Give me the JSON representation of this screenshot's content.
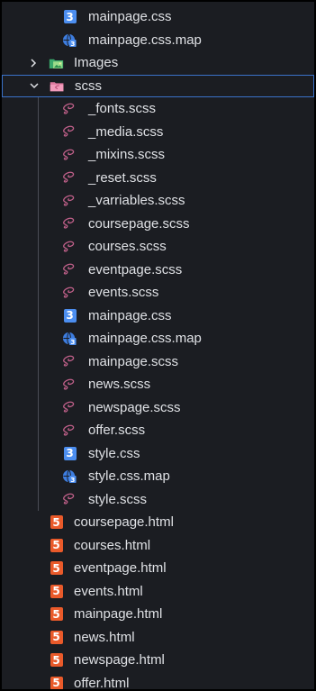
{
  "explorer": {
    "rows": [
      {
        "label": "mainpage.css",
        "icon": "css-file-icon",
        "level": 2
      },
      {
        "label": "mainpage.css.map",
        "icon": "css-map-file-icon",
        "level": 2
      },
      {
        "label": "Images",
        "icon": "images-folder-icon",
        "level": 1,
        "folder": "collapsed"
      },
      {
        "label": "scss",
        "icon": "sass-folder-icon",
        "level": 1,
        "folder": "expanded",
        "selected": true
      },
      {
        "label": "_fonts.scss",
        "icon": "sass-file-icon",
        "level": 2
      },
      {
        "label": "_media.scss",
        "icon": "sass-file-icon",
        "level": 2
      },
      {
        "label": "_mixins.scss",
        "icon": "sass-file-icon",
        "level": 2
      },
      {
        "label": "_reset.scss",
        "icon": "sass-file-icon",
        "level": 2
      },
      {
        "label": "_varriables.scss",
        "icon": "sass-file-icon",
        "level": 2
      },
      {
        "label": "coursepage.scss",
        "icon": "sass-file-icon",
        "level": 2
      },
      {
        "label": "courses.scss",
        "icon": "sass-file-icon",
        "level": 2
      },
      {
        "label": "eventpage.scss",
        "icon": "sass-file-icon",
        "level": 2
      },
      {
        "label": "events.scss",
        "icon": "sass-file-icon",
        "level": 2
      },
      {
        "label": "mainpage.css",
        "icon": "css-file-icon",
        "level": 2
      },
      {
        "label": "mainpage.css.map",
        "icon": "css-map-file-icon",
        "level": 2
      },
      {
        "label": "mainpage.scss",
        "icon": "sass-file-icon",
        "level": 2
      },
      {
        "label": "news.scss",
        "icon": "sass-file-icon",
        "level": 2
      },
      {
        "label": "newspage.scss",
        "icon": "sass-file-icon",
        "level": 2
      },
      {
        "label": "offer.scss",
        "icon": "sass-file-icon",
        "level": 2
      },
      {
        "label": "style.css",
        "icon": "css-file-icon",
        "level": 2
      },
      {
        "label": "style.css.map",
        "icon": "css-map-file-icon",
        "level": 2
      },
      {
        "label": "style.scss",
        "icon": "sass-file-icon",
        "level": 2
      },
      {
        "label": "coursepage.html",
        "icon": "html-file-icon",
        "level": 1
      },
      {
        "label": "courses.html",
        "icon": "html-file-icon",
        "level": 1
      },
      {
        "label": "eventpage.html",
        "icon": "html-file-icon",
        "level": 1
      },
      {
        "label": "events.html",
        "icon": "html-file-icon",
        "level": 1
      },
      {
        "label": "mainpage.html",
        "icon": "html-file-icon",
        "level": 1
      },
      {
        "label": "news.html",
        "icon": "html-file-icon",
        "level": 1
      },
      {
        "label": "newspage.html",
        "icon": "html-file-icon",
        "level": 1
      },
      {
        "label": "offer.html",
        "icon": "html-file-icon",
        "level": 1
      }
    ]
  },
  "colors": {
    "background": "#1b1d22",
    "text": "#dfe1e5",
    "css": "#4c8ef0",
    "html": "#ea5a2a",
    "sass": "#c0608a",
    "selection_border": "#3a72c8"
  }
}
